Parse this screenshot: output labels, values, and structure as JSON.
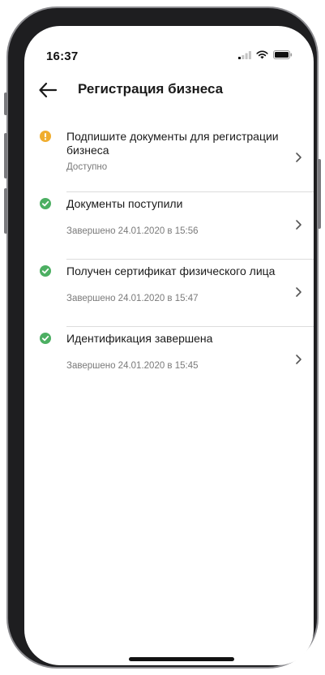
{
  "status_bar": {
    "time": "16:37"
  },
  "header": {
    "title": "Регистрация бизнеса"
  },
  "colors": {
    "warning": "#f0ad2e",
    "success": "#4caf62",
    "text": "#1a1a1a",
    "subtext": "#7a7a7a"
  },
  "steps": [
    {
      "title": "Подпишите документы для регистрации бизнеса",
      "subtitle": "Доступно",
      "status": "warning",
      "icon": "exclamation-icon"
    },
    {
      "title": "Документы поступили",
      "subtitle": "Завершено 24.01.2020 в 15:56",
      "status": "done",
      "icon": "check-icon"
    },
    {
      "title": "Получен сертификат физического лица",
      "subtitle": "Завершено 24.01.2020 в 15:47",
      "status": "done",
      "icon": "check-icon"
    },
    {
      "title": "Идентификация завершена",
      "subtitle": "Завершено 24.01.2020 в 15:45",
      "status": "done",
      "icon": "check-icon"
    }
  ]
}
